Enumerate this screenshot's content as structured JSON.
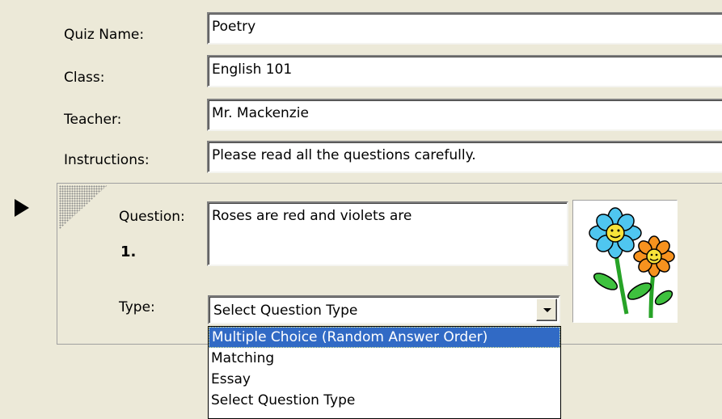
{
  "form": {
    "quiz_name_label": "Quiz Name:",
    "quiz_name_value": "Poetry",
    "class_label": "Class:",
    "class_value": "English 101",
    "teacher_label": "Teacher:",
    "teacher_value": "Mr. Mackenzie",
    "instructions_label": "Instructions:",
    "instructions_value": "Please read all the questions carefully."
  },
  "question": {
    "label": "Question:",
    "number": "1.",
    "text": "Roses are red and violets are",
    "type_label": "Type:",
    "type_value": "Select Question Type",
    "image_icon": "flowers-clipart-icon"
  },
  "dropdown": {
    "options": [
      "Multiple Choice (Random Answer Order)",
      "Matching",
      "Essay",
      "Select Question Type"
    ],
    "highlighted": "Multiple Choice (Random Answer Order)"
  },
  "colors": {
    "window_bg": "#ece9d8",
    "selection_bg": "#316ac5"
  }
}
